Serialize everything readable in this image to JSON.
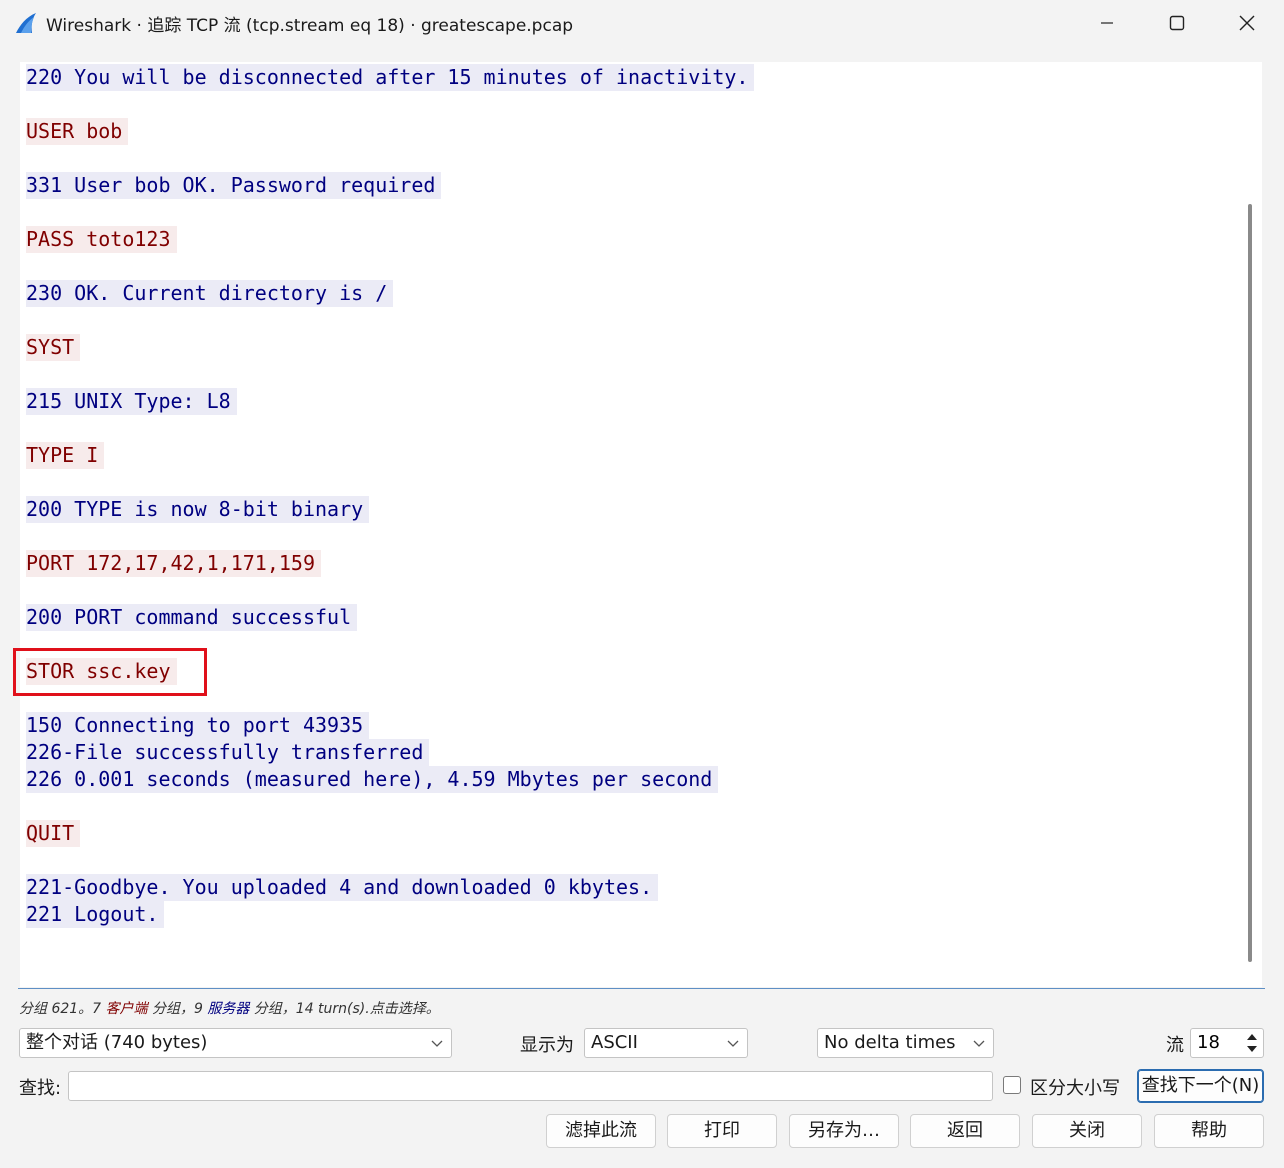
{
  "window": {
    "title": "Wireshark · 追踪 TCP 流 (tcp.stream eq 18) · greatescape.pcap",
    "icon": "wireshark-fin-icon",
    "minimize_icon": "minimize-icon",
    "maximize_icon": "maximize-icon",
    "close_icon": "close-icon"
  },
  "stream": {
    "lines": [
      {
        "text": "220 You will be disconnected after 15 minutes of inactivity.",
        "side": "server"
      },
      {
        "text": "USER bob",
        "side": "client"
      },
      {
        "text": "331 User bob OK. Password required",
        "side": "server"
      },
      {
        "text": "PASS toto123",
        "side": "client"
      },
      {
        "text": "230 OK. Current directory is /",
        "side": "server"
      },
      {
        "text": "SYST",
        "side": "client"
      },
      {
        "text": "215 UNIX Type: L8",
        "side": "server"
      },
      {
        "text": "TYPE I",
        "side": "client"
      },
      {
        "text": "200 TYPE is now 8-bit binary",
        "side": "server"
      },
      {
        "text": "PORT 172,17,42,1,171,159",
        "side": "client"
      },
      {
        "text": "200 PORT command successful",
        "side": "server"
      },
      {
        "text": "STOR ssc.key",
        "side": "client",
        "highlighted": true
      },
      {
        "text": "150 Connecting to port 43935",
        "side": "server"
      },
      {
        "text": "226-File successfully transferred",
        "side": "server"
      },
      {
        "text": "226 0.001 seconds (measured here), 4.59 Mbytes per second",
        "side": "server"
      },
      {
        "text": "QUIT",
        "side": "client"
      },
      {
        "text": "221-Goodbye. You uploaded 4 and downloaded 0 kbytes.",
        "side": "server"
      },
      {
        "text": "221 Logout.",
        "side": "server"
      }
    ]
  },
  "status": {
    "prefix": "分组 621。7 ",
    "client_word": "客户端",
    "middle": " 分组，9 ",
    "server_word": "服务器",
    "suffix": " 分组，14 turn(s).点击选择。"
  },
  "controls": {
    "conversation_select": "整个对话 (740 bytes)",
    "show_as_label": "显示为",
    "show_as_value": "ASCII",
    "delta_select": "No delta times",
    "stream_label": "流",
    "stream_value": "18",
    "find_label": "查找:",
    "find_value": "",
    "case_sensitive_label": "区分大小写",
    "find_next_button": "查找下一个(N)"
  },
  "buttons": {
    "filter_out": "滤掉此流",
    "print": "打印",
    "save_as": "另存为…",
    "back": "返回",
    "close": "关闭",
    "help": "帮助"
  },
  "colors": {
    "client_text": "#800000",
    "client_bg": "#f7ebeb",
    "server_text": "#000080",
    "server_bg": "#ebebf6",
    "highlight_box": "#e0101a"
  }
}
